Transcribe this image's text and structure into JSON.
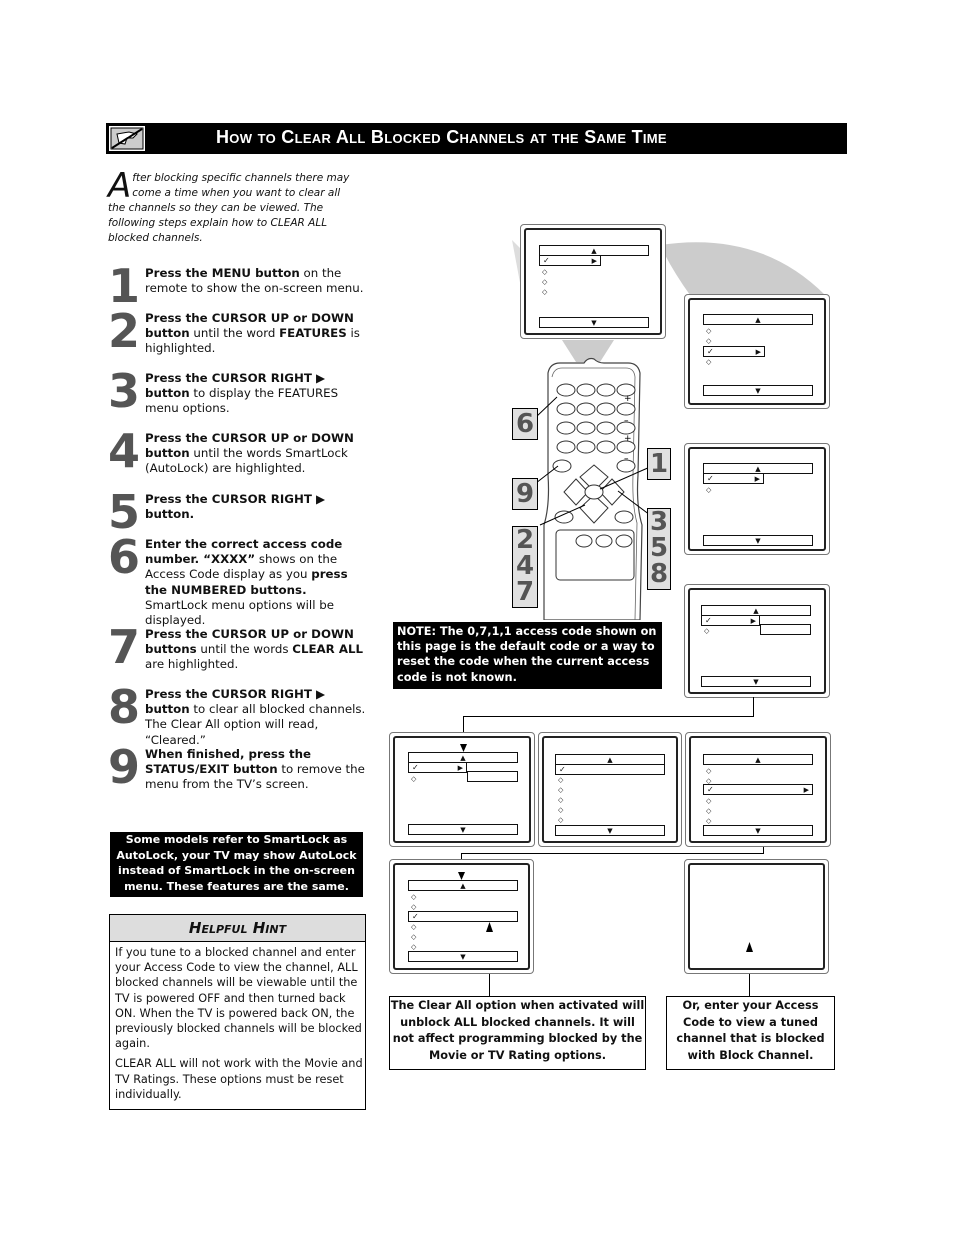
{
  "header": {
    "title": "How to Clear All Blocked Channels at the Same Time",
    "icon": "hand-no-touch-icon"
  },
  "intro": {
    "drop_cap": "A",
    "text": "fter blocking specific channels there may come a time when you want to clear all the channels so they can be viewed. The following steps explain how to CLEAR ALL blocked channels."
  },
  "steps": [
    {
      "num": "1",
      "bold": "Press the MENU button",
      "rest": " on the remote to show the on-screen menu."
    },
    {
      "num": "2",
      "bold": "Press the CURSOR UP     or DOWN     button",
      "rest": " until the word ",
      "bold2": "FEATURES",
      "rest2": " is highlighted."
    },
    {
      "num": "3",
      "bold": "Press the CURSOR RIGHT ▶ button",
      "rest": " to display the FEATURES menu options."
    },
    {
      "num": "4",
      "bold": "Press the CURSOR UP     or DOWN     button",
      "rest": " until the words SmartLock (AutoLock) are highlighted."
    },
    {
      "num": "5",
      "bold": "Press the CURSOR RIGHT ▶ button.",
      "rest": ""
    },
    {
      "num": "6",
      "bold": "Enter the correct access code number. “XXXX”",
      "rest": " shows on the Access Code display as you ",
      "bold2": "press the NUMBERED buttons.",
      "rest2": " SmartLock menu options will be displayed."
    },
    {
      "num": "7",
      "bold": "Press the CURSOR UP     or DOWN     buttons",
      "rest": " until the words ",
      "bold2": "CLEAR ALL",
      "rest2": " are highlighted."
    },
    {
      "num": "8",
      "bold": "Press the CURSOR RIGHT ▶ button",
      "rest": " to clear all blocked channels. The Clear All option will read, “Cleared.”"
    },
    {
      "num": "9",
      "bold": "When finished, press the STATUS/EXIT button",
      "rest": " to remove the menu from the TV’s screen."
    }
  ],
  "smartlock_note": "Some models refer to SmartLock as AutoLock, your TV may show AutoLock instead of SmartLock in the on-screen menu. These features are the same.",
  "hint": {
    "title": "Helpful Hint",
    "paragraphs": [
      "If you tune to a blocked channel and enter your Access Code to view the channel, ALL blocked channels will be viewable until the TV is powered OFF and then turned back ON. When the TV is powered back ON, the previously blocked channels will be blocked again.",
      "CLEAR ALL will not work with the Movie and TV Ratings. These options must be reset individually."
    ]
  },
  "remote_callouts": {
    "left_top": "6",
    "left_mid": "9",
    "left_bottom": [
      "2",
      "4",
      "7"
    ],
    "right_top": "1",
    "right_bottom": [
      "3",
      "5",
      "8"
    ]
  },
  "note": "NOTE: The 0,7,1,1 access code shown on this page is the default code or a way to reset the code when the current access code is not known.",
  "captions": {
    "clear_all": "The Clear All option when activated will unblock ALL blocked channels. It will not affect programming blocked by the Movie or TV Rating options.",
    "access_code": "Or, enter your Access Code to view a tuned channel that is blocked with Block Channel."
  },
  "icons": {
    "up": "▲",
    "down": "▼",
    "right": "▶",
    "check": "✓",
    "dot": "◇"
  }
}
